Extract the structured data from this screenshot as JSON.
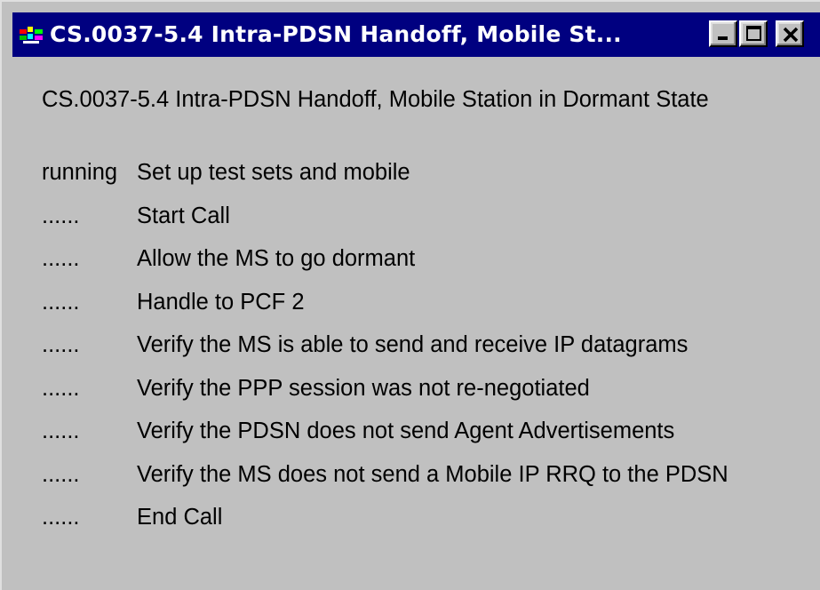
{
  "window": {
    "title": "CS.0037-5.4 Intra-PDSN Handoff, Mobile St...",
    "icon": "app-icon",
    "controls": {
      "minimize": "minimize-icon",
      "maximize": "maximize-icon",
      "close": "close-icon"
    }
  },
  "main": {
    "heading": "CS.0037-5.4 Intra-PDSN Handoff, Mobile Station in Dormant State",
    "steps": [
      {
        "status": "running",
        "label": "Set up test sets and mobile"
      },
      {
        "status": "......",
        "label": "Start Call"
      },
      {
        "status": "......",
        "label": "Allow the MS to go dormant"
      },
      {
        "status": "......",
        "label": "Handle to PCF 2"
      },
      {
        "status": "......",
        "label": "Verify the MS is able to send and receive IP datagrams"
      },
      {
        "status": "......",
        "label": "Verify the PPP session was not re-negotiated"
      },
      {
        "status": "......",
        "label": "Verify the PDSN does not send Agent Advertisements"
      },
      {
        "status": "......",
        "label": "Verify the MS does not send a Mobile IP RRQ to the PDSN"
      },
      {
        "status": "......",
        "label": "End Call"
      }
    ]
  },
  "colors": {
    "titlebar": "#000080",
    "window_face": "#c0c0c0",
    "title_text": "#ffffff"
  }
}
